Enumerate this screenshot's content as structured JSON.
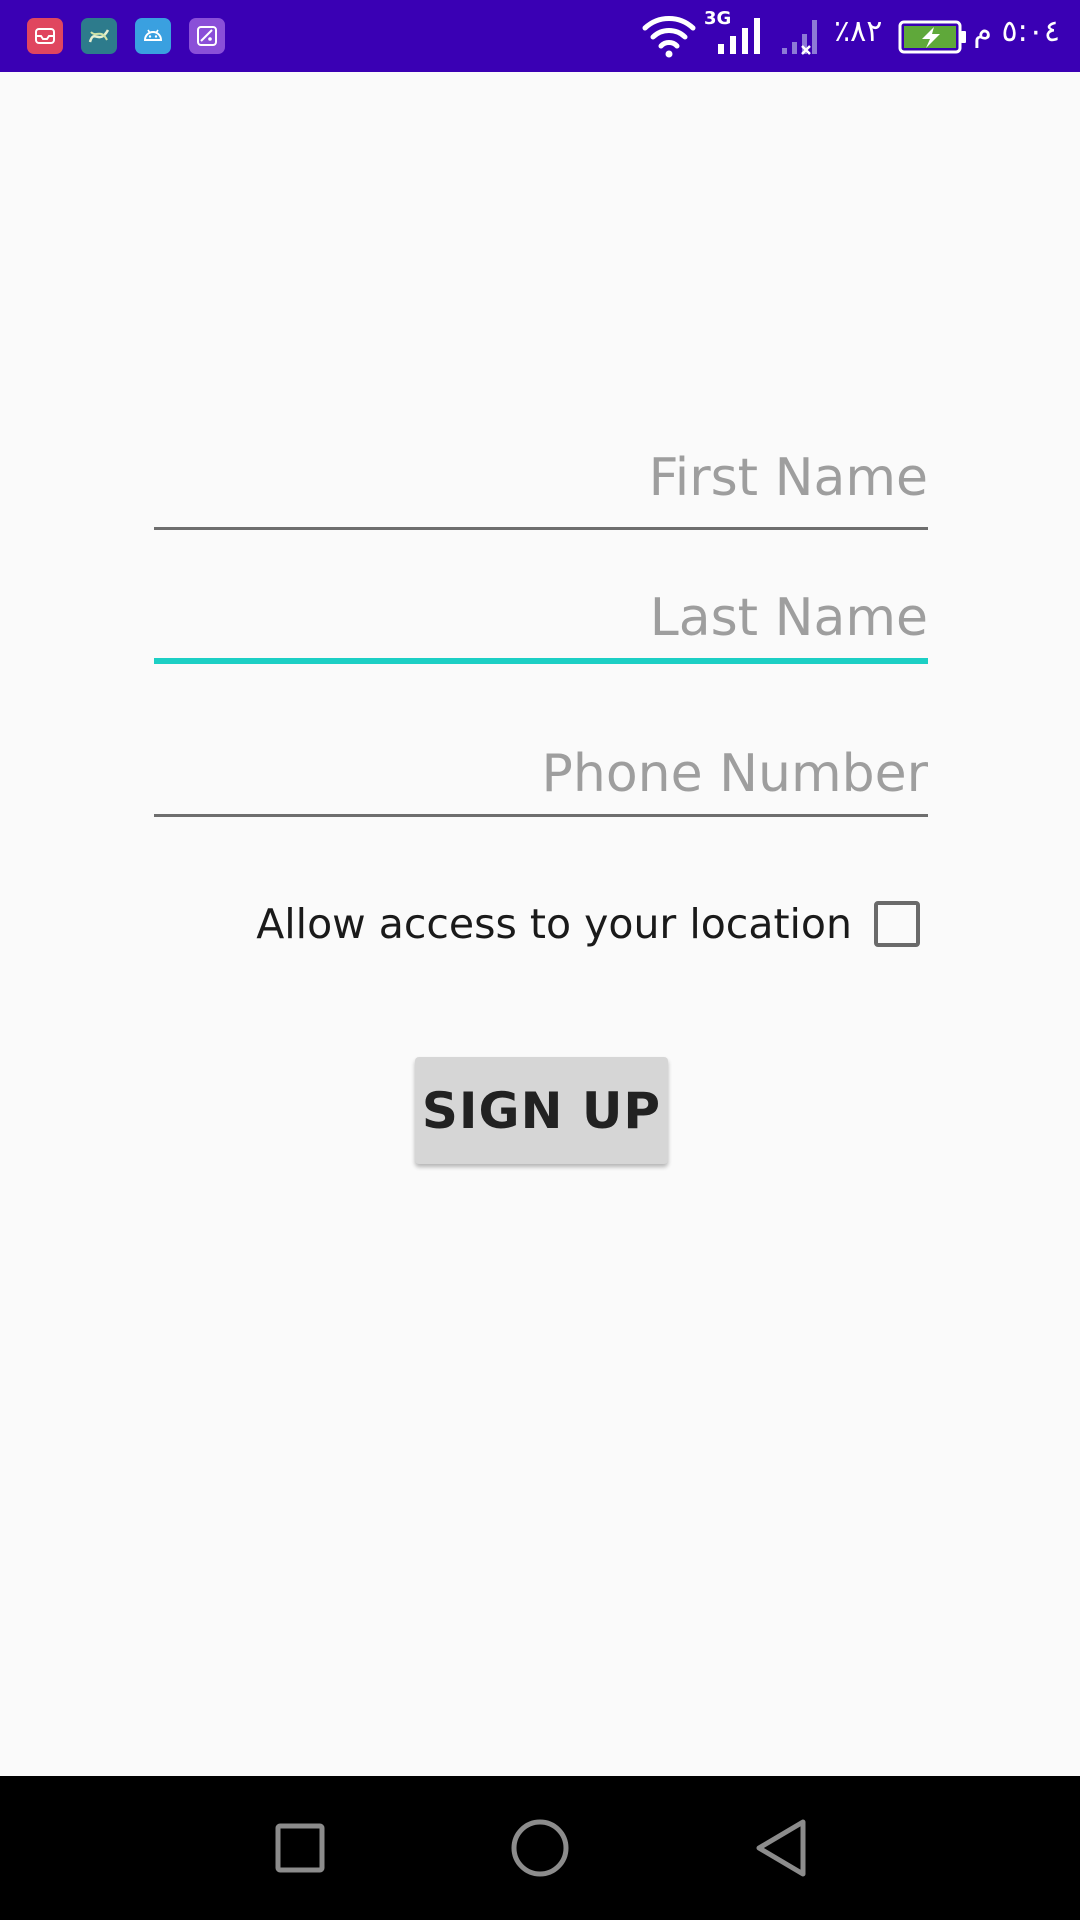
{
  "status_bar": {
    "time": "٥:٠٤ م",
    "battery_text": "٪٨٢",
    "network_type": "3G",
    "background_color": "#3a00b4",
    "notification_icons": [
      "mail-app-icon",
      "calligraphy-app-icon",
      "android-app-icon",
      "gallery-app-icon"
    ]
  },
  "form": {
    "first_name_placeholder": "First Name",
    "last_name_placeholder": "Last Name",
    "phone_placeholder": "Phone Number",
    "location_label": "Allow access to your location",
    "location_checked": false,
    "signup_label": "SIGN UP",
    "focused_field": "last_name",
    "accent_color": "#1ccfc4"
  },
  "nav_bar": {
    "buttons": [
      "recents-square-icon",
      "home-circle-icon",
      "back-triangle-icon"
    ]
  }
}
